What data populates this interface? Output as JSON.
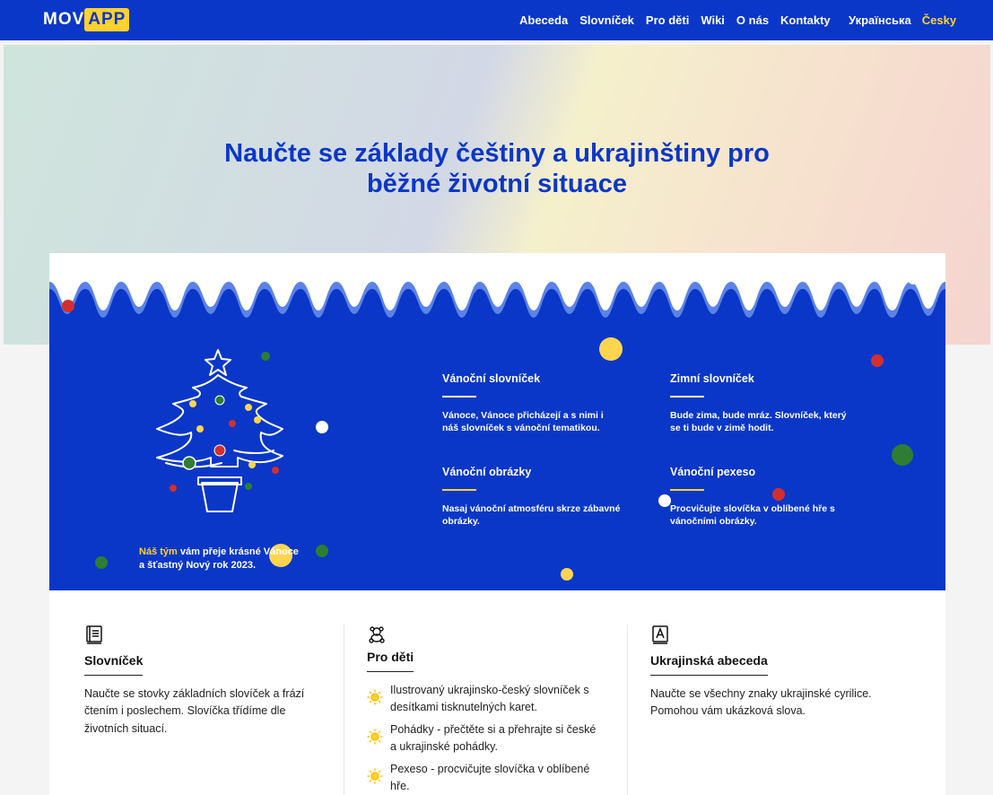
{
  "header": {
    "logo_left": "MOV",
    "logo_right": "APP",
    "nav": [
      "Abeceda",
      "Slovníček",
      "Pro děti",
      "Wiki",
      "O nás",
      "Kontakty"
    ],
    "lang_ua": "Українська",
    "lang_cz": "Česky"
  },
  "hero": {
    "title_line1": "Naučte se základy češtiny a ukrajinštiny pro",
    "title_line2": "běžné životní situace"
  },
  "banner": {
    "greeting_team": "Náš tým",
    "greeting_rest1": " vám přeje krásné Vánoce",
    "greeting_rest2": "a šťastný Nový rok 2023.",
    "features": [
      {
        "title": "Vánoční slovníček",
        "text": "Vánoce, Vánoce přicházejí a s nimi i náš slovníček s vánoční tematikou."
      },
      {
        "title": "Zimní slovníček",
        "text": "Bude zima, bude mráz. Slovníček, který se ti bude v zimě hodit."
      },
      {
        "title": "Vánoční obrázky",
        "text": "Nasaj vánoční atmosféru skrze zábavné obrázky."
      },
      {
        "title": "Vánoční pexeso",
        "text": "Procvičujte slovíčka v oblíbené hře s vánočními obrázky."
      }
    ]
  },
  "cards": {
    "slovnicek": {
      "icon": "book-icon",
      "title": "Slovníček",
      "text": "Naučte se stovky základních slovíček a frází čtením i poslechem. Slovíčka třídíme dle životních situací."
    },
    "prodeti": {
      "icon": "teddy-bear-icon",
      "title": "Pro děti",
      "items": [
        "Ilustrovaný ukrajinsko-český slovníček s desítkami tisknutelných karet.",
        "Pohádky - přečtěte si a přehrajte si české a ukrajinské pohádky.",
        "Pexeso - procvičujte slovíčka v oblíbené hře."
      ]
    },
    "abeceda": {
      "icon": "alphabet-book-icon",
      "title": "Ukrajinská abeceda",
      "text": "Naučte se všechny znaky ukrajinské cyrilice. Pomohou vám ukázková slova."
    }
  },
  "colors": {
    "brand_blue": "#0a37c7",
    "accent_yellow": "#ffd22e"
  }
}
